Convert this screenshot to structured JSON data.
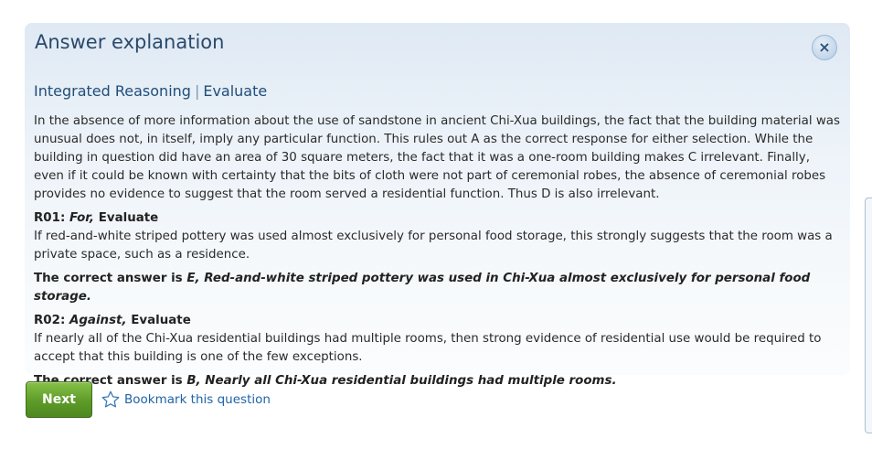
{
  "panel": {
    "title": "Answer explanation",
    "close_label": "×",
    "subtitle_left": "Integrated Reasoning",
    "subtitle_sep": "|",
    "subtitle_right": "Evaluate"
  },
  "explanation": {
    "intro": "In the absence of more information about the use of sandstone in ancient Chi-Xua buildings, the fact that the building material was unusual does not, in itself, imply any particular function. This rules out A as the correct response for either selection. While the building in question did have an area of 30 square meters, the fact that it was a one-room building makes C irrelevant. Finally, even if it could be known with certainty that the bits of cloth were not part of ceremonial robes, the absence of ceremonial robes provides no evidence to suggest that the room served a residential function. Thus D is also irrelevant.",
    "r01": {
      "code": "R01:",
      "stance": "For,",
      "type": "Evaluate",
      "text": "If red-and-white striped pottery was used almost exclusively for personal food storage, this strongly suggests that the room was a private space, such as a residence.",
      "answer_prefix": "The correct answer is",
      "answer": "E, Red-and-white striped pottery was used in Chi-Xua almost exclusively for personal food storage."
    },
    "r02": {
      "code": "R02:",
      "stance": "Against,",
      "type": "Evaluate",
      "text": "If nearly all of the Chi-Xua residential buildings had multiple rooms, then strong evidence of residential use would be required to accept that this building is one of the few exceptions.",
      "answer_prefix": "The correct answer is",
      "answer": "B, Nearly all Chi-Xua residential buildings had multiple rooms."
    }
  },
  "actions": {
    "next_label": "Next",
    "bookmark_label": "Bookmark this question",
    "bookmark_icon": "star-outline-icon"
  },
  "colors": {
    "title": "#2a4a6b",
    "subtitle": "#1f4e79",
    "next_button": "#5d9b29",
    "link": "#1e63a8"
  }
}
